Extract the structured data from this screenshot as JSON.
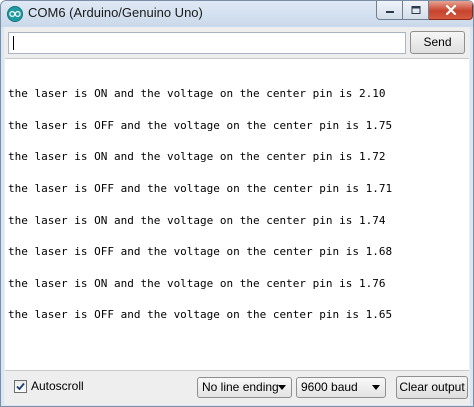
{
  "window": {
    "title": "COM6 (Arduino/Genuino Uno)"
  },
  "toolbar": {
    "input_value": "",
    "send_label": "Send"
  },
  "output": {
    "lines": [
      "the laser is ON and the voltage on the center pin is 2.10",
      "the laser is OFF and the voltage on the center pin is 1.75",
      "the laser is ON and the voltage on the center pin is 1.72",
      "the laser is OFF and the voltage on the center pin is 1.71",
      "the laser is ON and the voltage on the center pin is 1.74",
      "the laser is OFF and the voltage on the center pin is 1.68",
      "the laser is ON and the voltage on the center pin is 1.76",
      "the laser is OFF and the voltage on the center pin is 1.65"
    ]
  },
  "footer": {
    "autoscroll_label": "Autoscroll",
    "autoscroll_checked": true,
    "line_ending": "No line ending",
    "baud_rate": "9600 baud",
    "clear_label": "Clear output"
  },
  "icons": {
    "app": "arduino-icon",
    "minimize": "minimize-icon",
    "maximize": "maximize-icon",
    "close": "close-icon"
  },
  "colors": {
    "close_button": "#c7432e",
    "titlebar": "#c9d8ea"
  }
}
